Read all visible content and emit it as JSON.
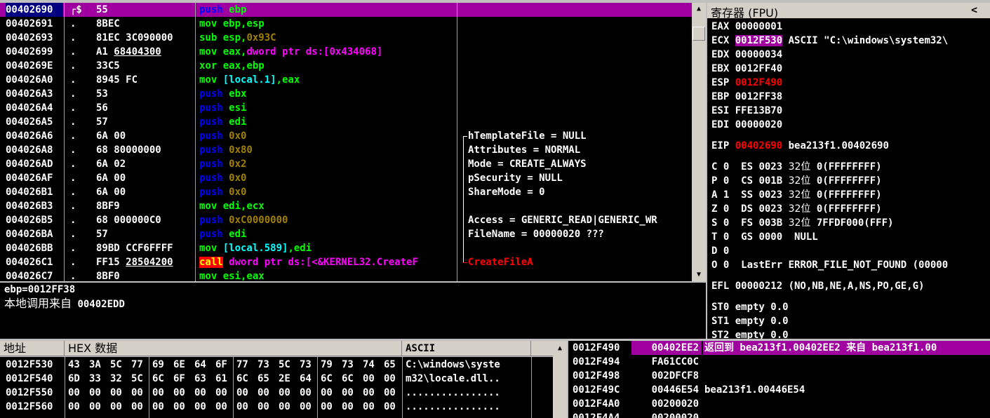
{
  "colors": {
    "selection": "#a000a0",
    "background": "#000000",
    "text": "#ffffff",
    "address": "#ffff00",
    "register_changed": "#ff0000"
  },
  "disasm": {
    "rows": [
      {
        "addr": "00402690",
        "mark": "r$",
        "hex": "55",
        "ins": [
          [
            "push",
            "b"
          ],
          [
            " ebp",
            "g"
          ]
        ],
        "selected": true
      },
      {
        "addr": "00402691",
        "mark": ".",
        "hex": "8BEC",
        "ins": [
          [
            "mov ebp,esp",
            "g"
          ]
        ]
      },
      {
        "addr": "00402693",
        "mark": ".",
        "hex": "81EC 3C090000",
        "ins": [
          [
            "sub esp,",
            "g"
          ],
          [
            "0x93C",
            "o"
          ]
        ]
      },
      {
        "addr": "00402699",
        "mark": ".",
        "hex": "A1 68404300",
        "hex_underline": "68404300",
        "ins": [
          [
            "mov eax,",
            "g"
          ],
          [
            "dword ptr ds:[0x434068]",
            "m"
          ]
        ]
      },
      {
        "addr": "0040269E",
        "mark": ".",
        "hex": "33C5",
        "ins": [
          [
            "xor eax,ebp",
            "g"
          ]
        ]
      },
      {
        "addr": "004026A0",
        "mark": ".",
        "hex": "8945 FC",
        "ins": [
          [
            "mov ",
            "g"
          ],
          [
            "[local.1]",
            "c"
          ],
          [
            ",eax",
            "g"
          ]
        ]
      },
      {
        "addr": "004026A3",
        "mark": ".",
        "hex": "53",
        "ins": [
          [
            "push",
            "b"
          ],
          [
            " ebx",
            "g"
          ]
        ]
      },
      {
        "addr": "004026A4",
        "mark": ".",
        "hex": "56",
        "ins": [
          [
            "push",
            "b"
          ],
          [
            " esi",
            "g"
          ]
        ]
      },
      {
        "addr": "004026A5",
        "mark": ".",
        "hex": "57",
        "ins": [
          [
            "push",
            "b"
          ],
          [
            " edi",
            "g"
          ]
        ]
      },
      {
        "addr": "004026A6",
        "mark": ".",
        "hex": "6A 00",
        "ins": [
          [
            "push",
            "b"
          ],
          [
            " 0x0",
            "o"
          ]
        ]
      },
      {
        "addr": "004026A8",
        "mark": ".",
        "hex": "68 80000000",
        "ins": [
          [
            "push",
            "b"
          ],
          [
            " 0x80",
            "o"
          ]
        ]
      },
      {
        "addr": "004026AD",
        "mark": ".",
        "hex": "6A 02",
        "ins": [
          [
            "push",
            "b"
          ],
          [
            " 0x2",
            "o"
          ]
        ]
      },
      {
        "addr": "004026AF",
        "mark": ".",
        "hex": "6A 00",
        "ins": [
          [
            "push",
            "b"
          ],
          [
            " 0x0",
            "o"
          ]
        ]
      },
      {
        "addr": "004026B1",
        "mark": ".",
        "hex": "6A 00",
        "ins": [
          [
            "push",
            "b"
          ],
          [
            " 0x0",
            "o"
          ]
        ]
      },
      {
        "addr": "004026B3",
        "mark": ".",
        "hex": "8BF9",
        "ins": [
          [
            "mov edi,ecx",
            "g"
          ]
        ]
      },
      {
        "addr": "004026B5",
        "mark": ".",
        "hex": "68 000000C0",
        "ins": [
          [
            "push",
            "b"
          ],
          [
            " 0xC0000000",
            "o"
          ]
        ]
      },
      {
        "addr": "004026BA",
        "mark": ".",
        "hex": "57",
        "ins": [
          [
            "push",
            "b"
          ],
          [
            " edi",
            "g"
          ]
        ]
      },
      {
        "addr": "004026BB",
        "mark": ".",
        "hex": "89BD CCF6FFFF",
        "ins": [
          [
            "mov ",
            "g"
          ],
          [
            "[local.589]",
            "c"
          ],
          [
            ",edi",
            "g"
          ]
        ]
      },
      {
        "addr": "004026C1",
        "mark": ".",
        "hex": "FF15 28504200",
        "hex_underline": "28504200",
        "ins": [
          [
            "call",
            "callbg"
          ],
          [
            " dword ptr ds:[<&KERNEL32.CreateF",
            "m"
          ]
        ]
      },
      {
        "addr": "004026C7",
        "mark": ".",
        "hex": "8BF0",
        "ins": [
          [
            "mov esi,eax",
            "g"
          ]
        ]
      }
    ],
    "comments": [
      {
        "row": 9,
        "text": "hTemplateFile = NULL",
        "bracket": "top"
      },
      {
        "row": 10,
        "text": "Attributes = NORMAL"
      },
      {
        "row": 11,
        "text": "Mode = CREATE_ALWAYS"
      },
      {
        "row": 12,
        "text": "pSecurity = NULL"
      },
      {
        "row": 13,
        "text": "ShareMode = 0"
      },
      {
        "row": 15,
        "text": "Access = GENERIC_READ|GENERIC_WR"
      },
      {
        "row": 16,
        "text": "FileName = 00000020 ???"
      },
      {
        "row": 18,
        "text": "CreateFileA",
        "bracket": "bottom",
        "red": true
      }
    ]
  },
  "info": {
    "line1": "ebp=0012FF38",
    "line2_label": "本地调用来自",
    "line2_addr": "00402EDD"
  },
  "registers": {
    "title": "寄存器 (FPU)",
    "collapse": "<",
    "gp": [
      {
        "name": "EAX",
        "value": "00000001",
        "desc": ""
      },
      {
        "name": "ECX",
        "value": "0012F530",
        "desc": "ASCII \"C:\\windows\\system32\\",
        "highlight": true
      },
      {
        "name": "EDX",
        "value": "00000034",
        "desc": ""
      },
      {
        "name": "EBX",
        "value": "0012FF40",
        "desc": ""
      },
      {
        "name": "ESP",
        "value": "0012F490",
        "desc": "",
        "changed": true
      },
      {
        "name": "EBP",
        "value": "0012FF38",
        "desc": ""
      },
      {
        "name": "ESI",
        "value": "FFE13B70",
        "desc": ""
      },
      {
        "name": "EDI",
        "value": "00000020",
        "desc": ""
      }
    ],
    "eip": {
      "name": "EIP",
      "value": "00402690",
      "desc": "bea213f1.00402690"
    },
    "flags": [
      {
        "f": "C",
        "v": "0",
        "seg": "ES",
        "sel": "0023",
        "bits": "32位",
        "info": "0(FFFFFFFF)"
      },
      {
        "f": "P",
        "v": "0",
        "seg": "CS",
        "sel": "001B",
        "bits": "32位",
        "info": "0(FFFFFFFF)"
      },
      {
        "f": "A",
        "v": "1",
        "seg": "SS",
        "sel": "0023",
        "bits": "32位",
        "info": "0(FFFFFFFF)"
      },
      {
        "f": "Z",
        "v": "0",
        "seg": "DS",
        "sel": "0023",
        "bits": "32位",
        "info": "0(FFFFFFFF)"
      },
      {
        "f": "S",
        "v": "0",
        "seg": "FS",
        "sel": "003B",
        "bits": "32位",
        "info": "7FFDF000(FFF)"
      },
      {
        "f": "T",
        "v": "0",
        "seg": "GS",
        "sel": "0000",
        "bits": "",
        "info": "NULL"
      },
      {
        "f": "D",
        "v": "0",
        "seg": "",
        "sel": "",
        "bits": "",
        "info": ""
      }
    ],
    "lasterr": {
      "f": "O",
      "v": "0",
      "text": "LastErr ERROR_FILE_NOT_FOUND (00000"
    },
    "efl": "EFL 00000212 (NO,NB,NE,A,NS,PO,GE,G)",
    "fpu": [
      "ST0 empty 0.0",
      "ST1 empty 0.0",
      "ST2 empty 0.0"
    ]
  },
  "dump": {
    "headers": {
      "addr": "地址",
      "hex": "HEX 数据",
      "ascii": "ASCII"
    },
    "rows": [
      {
        "addr": "0012F530",
        "bytes": [
          "43",
          "3A",
          "5C",
          "77",
          "69",
          "6E",
          "64",
          "6F",
          "77",
          "73",
          "5C",
          "73",
          "79",
          "73",
          "74",
          "65"
        ],
        "ascii": "C:\\windows\\syste"
      },
      {
        "addr": "0012F540",
        "bytes": [
          "6D",
          "33",
          "32",
          "5C",
          "6C",
          "6F",
          "63",
          "61",
          "6C",
          "65",
          "2E",
          "64",
          "6C",
          "6C",
          "00",
          "00"
        ],
        "ascii": "m32\\locale.dll.."
      },
      {
        "addr": "0012F550",
        "bytes": [
          "00",
          "00",
          "00",
          "00",
          "00",
          "00",
          "00",
          "00",
          "00",
          "00",
          "00",
          "00",
          "00",
          "00",
          "00",
          "00"
        ],
        "ascii": "................"
      },
      {
        "addr": "0012F560",
        "bytes": [
          "00",
          "00",
          "00",
          "00",
          "00",
          "00",
          "00",
          "00",
          "00",
          "00",
          "00",
          "00",
          "00",
          "00",
          "00",
          "00"
        ],
        "ascii": "................"
      }
    ]
  },
  "stack": {
    "rows": [
      {
        "addr": "0012F490",
        "value": "00402EE2",
        "comment": "返回到 bea213f1.00402EE2 来自 bea213f1.00",
        "selected": true
      },
      {
        "addr": "0012F494",
        "value": "FA61CC0C",
        "comment": ""
      },
      {
        "addr": "0012F498",
        "value": "002DFCF8",
        "comment": ""
      },
      {
        "addr": "0012F49C",
        "value": "00446E54",
        "comment": "bea213f1.00446E54"
      },
      {
        "addr": "0012F4A0",
        "value": "00200020",
        "comment": ""
      },
      {
        "addr": "0012F4A4",
        "value": "00200020",
        "comment": ""
      }
    ]
  }
}
